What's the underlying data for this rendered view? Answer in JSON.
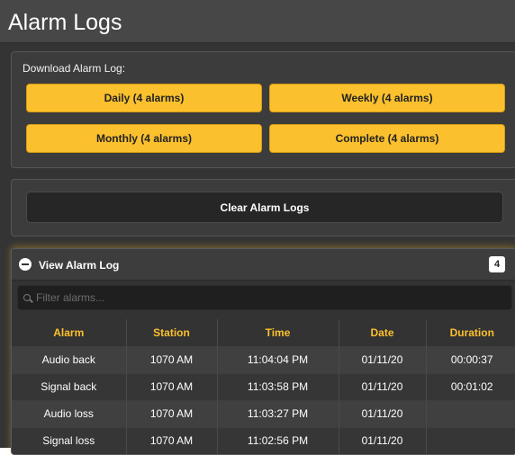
{
  "header": {
    "title": "Alarm Logs"
  },
  "download": {
    "label": "Download Alarm Log:",
    "buttons": [
      "Daily (4 alarms)",
      "Weekly (4 alarms)",
      "Monthly (4 alarms)",
      "Complete (4 alarms)"
    ]
  },
  "clear": {
    "label": "Clear Alarm Logs"
  },
  "log": {
    "title": "View Alarm Log",
    "count": "4",
    "filter_placeholder": "Filter alarms...",
    "columns": [
      "Alarm",
      "Station",
      "Time",
      "Date",
      "Duration"
    ],
    "rows": [
      [
        "Audio back",
        "1070 AM",
        "11:04:04 PM",
        "01/11/20",
        "00:00:37"
      ],
      [
        "Signal back",
        "1070 AM",
        "11:03:58 PM",
        "01/11/20",
        "00:01:02"
      ],
      [
        "Audio loss",
        "1070 AM",
        "11:03:27 PM",
        "01/11/20",
        ""
      ],
      [
        "Signal loss",
        "1070 AM",
        "11:02:56 PM",
        "01/11/20",
        ""
      ]
    ]
  },
  "colors": {
    "accent": "#fbc02d",
    "background": "#343434",
    "panel": "#3c3c3c"
  },
  "icons": {
    "collapse": "minus-circle-icon",
    "search": "search-icon"
  }
}
